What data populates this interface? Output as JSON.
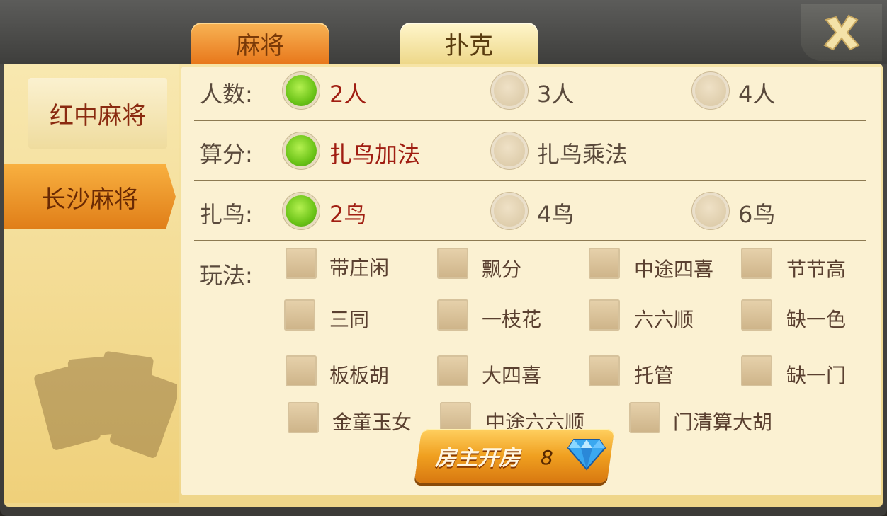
{
  "tabs": [
    {
      "label": "麻将",
      "active": true
    },
    {
      "label": "扑克",
      "active": false
    }
  ],
  "sidebar": {
    "items": [
      {
        "label": "红中麻将",
        "active": false
      },
      {
        "label": "长沙麻将",
        "active": true
      }
    ]
  },
  "rows": {
    "players": {
      "label": "人数:",
      "options": [
        "2人",
        "3人",
        "4人"
      ],
      "selected": "2人"
    },
    "scoring": {
      "label": "算分:",
      "options": [
        "扎鸟加法",
        "扎鸟乘法"
      ],
      "selected": "扎鸟加法"
    },
    "birds": {
      "label": "扎鸟:",
      "options": [
        "2鸟",
        "4鸟",
        "6鸟"
      ],
      "selected": "2鸟"
    },
    "rules": {
      "label": "玩法:",
      "options": [
        "带庄闲",
        "飘分",
        "中途四喜",
        "节节高",
        "三同",
        "一枝花",
        "六六顺",
        "缺一色",
        "板板胡",
        "大四喜",
        "托管",
        "缺一门",
        "金童玉女",
        "中途六六顺",
        "门清算大胡"
      ],
      "checked": []
    }
  },
  "create_button": {
    "label": "房主开房",
    "cost": "8",
    "icon": "diamond-icon"
  },
  "colors": {
    "selected_text": "#a01e12",
    "accent_orange": "#e8781c",
    "radio_on": "#6cc418"
  }
}
